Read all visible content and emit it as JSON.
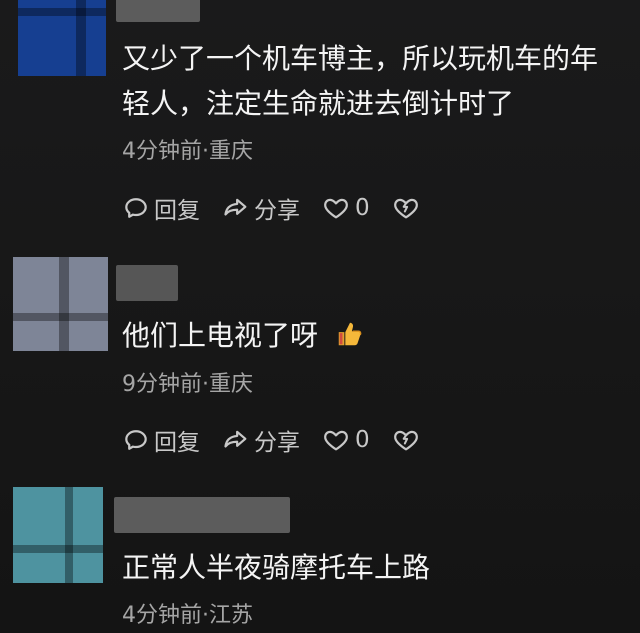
{
  "comments": [
    {
      "text": "又少了一个机车博主，所以玩机车的年轻人，注定生命就进去倒计时了",
      "meta": "4分钟前·重庆",
      "reply_label": "回复",
      "share_label": "分享",
      "like_count": "0",
      "avatar_color": "#163f91"
    },
    {
      "text": "他们上电视了呀",
      "meta": "9分钟前·重庆",
      "reply_label": "回复",
      "share_label": "分享",
      "like_count": "0",
      "avatar_color": "#7e8597",
      "emoji": "thumbs-up"
    },
    {
      "text": "正常人半夜骑摩托车上路",
      "meta": "4分钟前·江苏",
      "avatar_color": "#4e93a0"
    }
  ],
  "icons": {
    "reply": "comment-bubble-icon",
    "share": "share-arrow-icon",
    "like": "heart-icon",
    "dislike": "broken-heart-icon"
  }
}
